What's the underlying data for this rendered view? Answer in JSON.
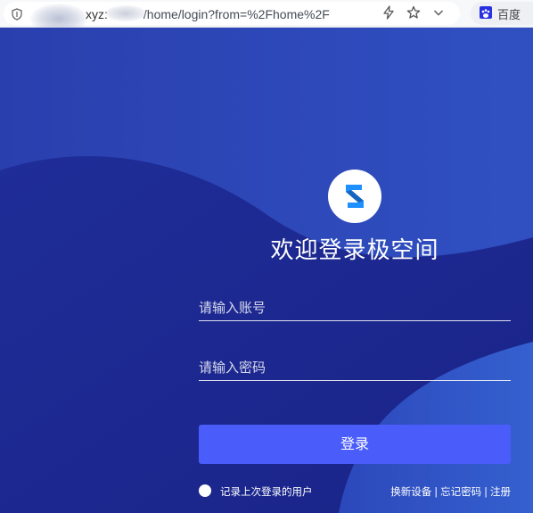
{
  "browser": {
    "url_host": "xyz:",
    "url_path": "/home/login?from=%2Fhome%2F",
    "search_engine_label": "百度",
    "icons": [
      "shield-icon",
      "lightning-icon",
      "star-icon",
      "chevron-down-icon",
      "baidu-paw-icon"
    ]
  },
  "login": {
    "title": "欢迎登录极空间",
    "account_placeholder": "请输入账号",
    "password_placeholder": "请输入密码",
    "submit_label": "登录",
    "remember_label": "记录上次登录的用户",
    "links": {
      "change_device": "换新设备",
      "forgot_password": "忘记密码",
      "register": "注册",
      "separator": "|"
    }
  },
  "colors": {
    "background": "#2437a6",
    "button": "#4a5dfb",
    "logo_accent": "#1e90ff"
  }
}
